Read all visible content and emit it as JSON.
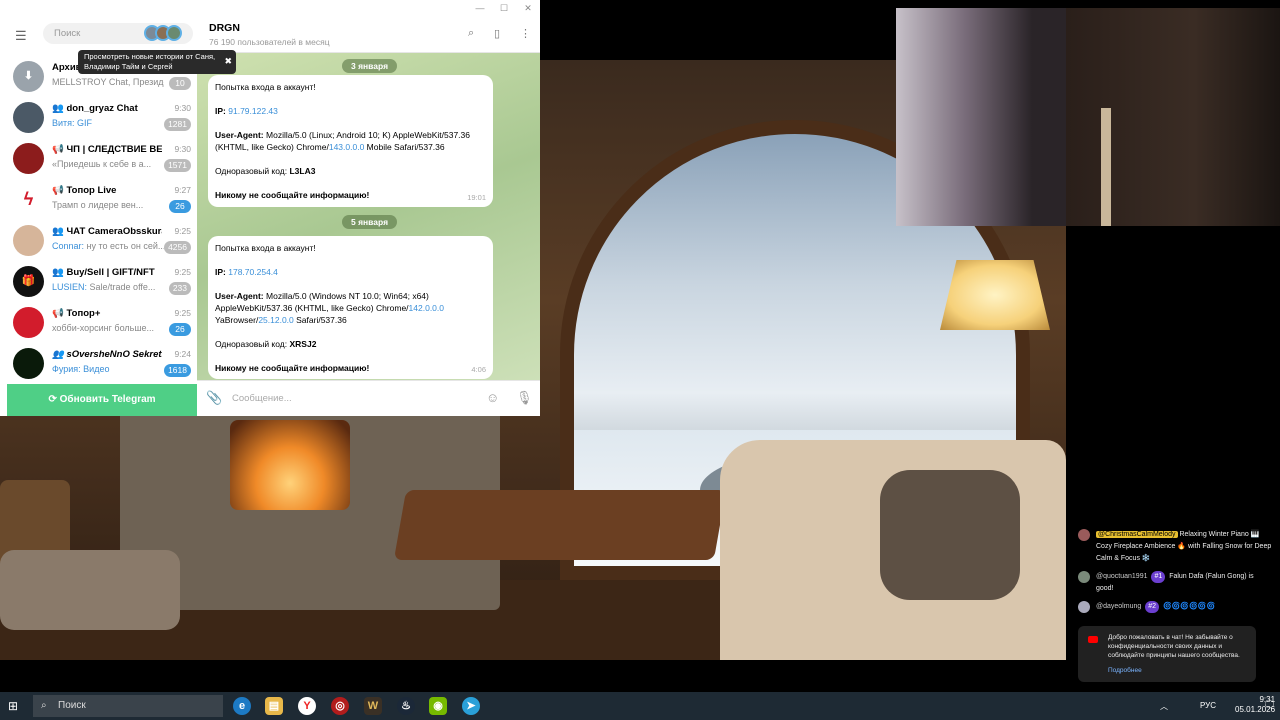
{
  "telegram": {
    "search_placeholder": "Поиск",
    "tooltip": "Просмотреть новые истории от Саня, Владимир Тайм и Сергей",
    "update_button": "Обновить Telegram",
    "dialogs": [
      {
        "name": "Архив",
        "time": "",
        "last_who": "",
        "last": "MELLSTROY Chat, Президе...",
        "count": "10",
        "count_color": "gray",
        "avatar_color": "#9aa3ab"
      },
      {
        "name": "don_gryaz Chat",
        "time": "9:30",
        "last_who": "Витя:",
        "last": "GIF",
        "count": "1281",
        "count_color": "gray",
        "avatar_color": "#4b5966"
      },
      {
        "name": "ЧП | СЛЕДСТВИЕ ВЕЛИ",
        "time": "9:30",
        "last_who": "",
        "last": "«Приедешь к себе в а...",
        "count": "1571",
        "count_color": "gray",
        "avatar_color": "#8c1c1c"
      },
      {
        "name": "Топор Live",
        "time": "9:27",
        "last_who": "",
        "last": "Трамп о лидере вен...",
        "count": "26",
        "count_color": "blue",
        "avatar_color": "#ffffff"
      },
      {
        "name": "ЧАТ CameraObsskura",
        "time": "9:25",
        "last_who": "Connar:",
        "last": "ну то есть он сей...",
        "count": "4256",
        "count_color": "gray",
        "avatar_color": "#d6b59a"
      },
      {
        "name": "Buy/Sell | GIFT/NFT",
        "time": "9:25",
        "last_who": "LUSIEN:",
        "last": "Sale/trade offe...",
        "count": "233",
        "count_color": "gray",
        "avatar_color": "#111111"
      },
      {
        "name": "Топор+",
        "time": "9:25",
        "last_who": "",
        "last": "хобби-хорсинг больше...",
        "count": "26",
        "count_color": "blue",
        "avatar_color": "#d21c2c"
      },
      {
        "name": "sOversheNnO SekretNo",
        "time": "9:24",
        "last_who": "Фурия:",
        "last": "Видео",
        "count": "1618",
        "count_color": "blue",
        "avatar_color": "#0a1a0a"
      }
    ],
    "chat": {
      "name": "DRGN",
      "subtitle": "76 190 пользователей в месяц",
      "composer_placeholder": "Сообщение...",
      "messages": [
        {
          "date": "3 января",
          "title": "Попытка входа в аккаунт!",
          "ip_label": "IP:",
          "ip": "91.79.122.43",
          "ua_label": "User-Agent:",
          "ua_1": "Mozilla/5.0 (Linux; Android 10; K) AppleWebKit/537.36 (KHTML, like Gecko) Chrome/",
          "ua_2": "143.0.0.0",
          "ua_3": " Mobile Safari/537.36",
          "code_label": "Одноразовый код:",
          "code": "L3LA3",
          "warning": "Никому не сообщайте информацию!",
          "time": "19:01"
        },
        {
          "date": "5 января",
          "title": "Попытка входа в аккаунт!",
          "ip_label": "IP:",
          "ip": "178.70.254.4",
          "ua_label": "User-Agent:",
          "ua_1": "Mozilla/5.0 (Windows NT 10.0; Win64; x64) AppleWebKit/537.36 (KHTML, like Gecko) Chrome/",
          "ua_2": "142.0.0.0",
          "ua_3": " YaBrowser/",
          "ua_4": "25.12.0.0",
          "ua_5": " Safari/537.36",
          "code_label": "Одноразовый код:",
          "code": "XRSJ2",
          "warning": "Никому не сообщайте информацию!",
          "time": "4:06"
        }
      ]
    }
  },
  "stream_chat": {
    "messages": [
      {
        "user": "@ChristmasCalmMelody",
        "text": "Relaxing Winter Piano 🎹 Cozy Fireplace Ambience 🔥 with Falling Snow for Deep Calm & Focus ❄️"
      },
      {
        "user": "@quoctuan1991",
        "rank": "#1",
        "text": "Falun Dafa (Falun Gong) is good!"
      },
      {
        "user": "@dayeolmung",
        "rank": "#2",
        "text": "🌀🌀🌀🌀🌀🌀"
      }
    ],
    "notice": "Добро пожаловать в чат! Не забывайте о конфиденциальности своих данных и соблюдайте принципы нашего сообщества.",
    "notice_more": "Подробнее"
  },
  "taskbar": {
    "search": "Поиск",
    "lang": "РУС",
    "time": "9:31",
    "date": "05.01.2026"
  },
  "colors": {
    "telegram_green": "#4fcf86",
    "link_blue": "#3a8fd8",
    "badge_blue": "#3a9be0"
  }
}
